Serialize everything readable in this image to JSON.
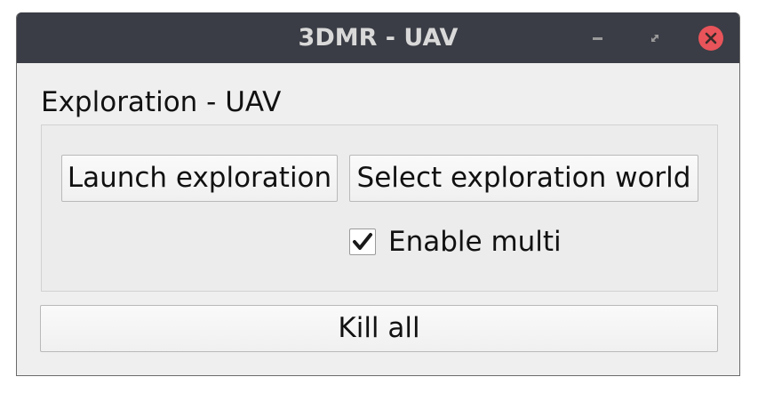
{
  "window": {
    "title": "3DMR - UAV",
    "controls": {
      "minimize_icon": "minimize-icon",
      "maximize_icon": "restore-icon",
      "close_icon": "close-icon",
      "close_color": "#e8545a"
    },
    "titlebar_color": "#3a3d45"
  },
  "group": {
    "title": "Exploration - UAV",
    "launch_label": "Launch exploration",
    "select_world_label": "Select exploration world",
    "enable_multi_label": "Enable multi",
    "enable_multi_checked": true
  },
  "kill_all_label": "Kill all"
}
